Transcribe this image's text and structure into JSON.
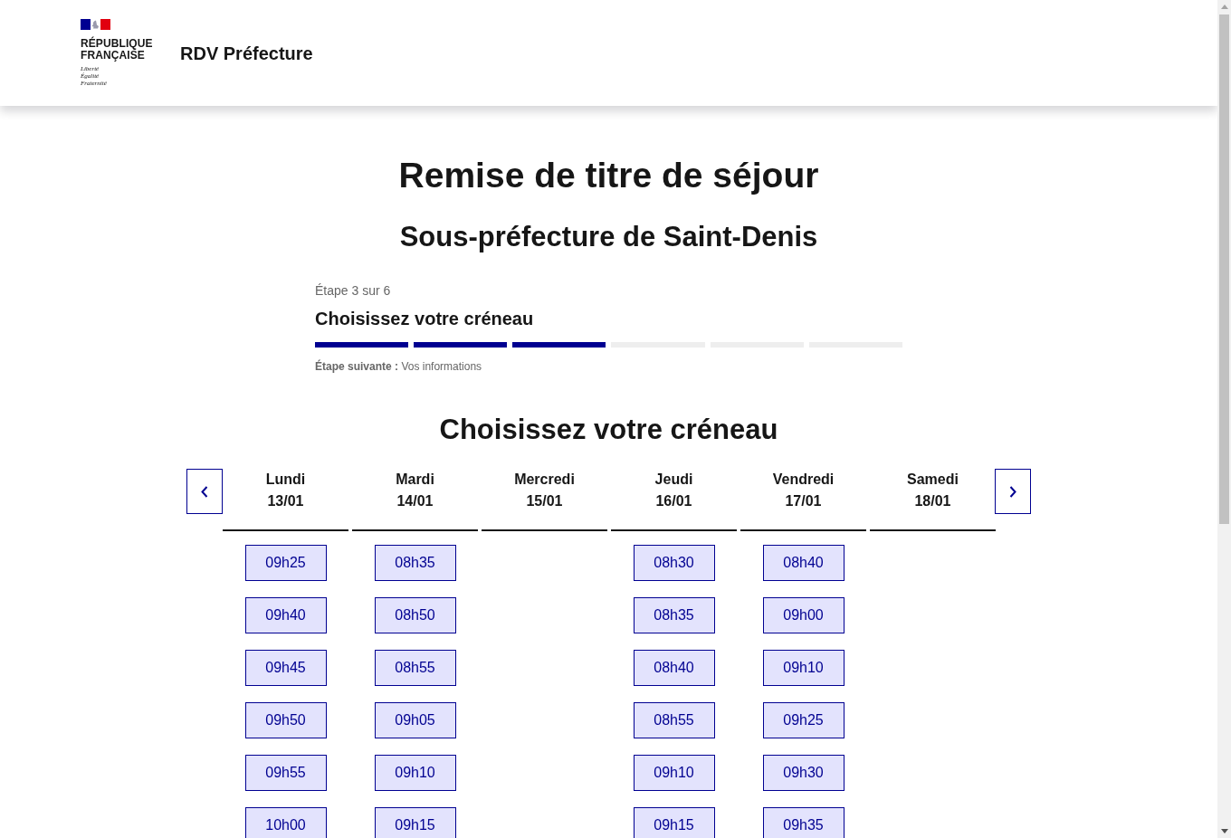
{
  "header": {
    "logo_name": "RÉPUBLIQUE\nFRANÇAISE",
    "motto": "Liberté\nÉgalité\nFraternité",
    "service_title": "RDV Préfecture"
  },
  "page": {
    "title": "Remise de titre de séjour",
    "subtitle": "Sous-préfecture de Saint-Denis"
  },
  "stepper": {
    "step_label": "Étape 3 sur 6",
    "current_title": "Choisissez votre créneau",
    "segments": [
      {
        "done": true
      },
      {
        "done": true
      },
      {
        "done": true
      },
      {
        "done": false
      },
      {
        "done": false
      },
      {
        "done": false
      }
    ],
    "next_label": "Étape suivante :",
    "next_value": "Vos informations"
  },
  "calendar": {
    "title": "Choisissez votre créneau",
    "days": [
      {
        "name": "Lundi",
        "date": "13/01",
        "slots": [
          "09h25",
          "09h40",
          "09h45",
          "09h50",
          "09h55",
          "10h00"
        ]
      },
      {
        "name": "Mardi",
        "date": "14/01",
        "slots": [
          "08h35",
          "08h50",
          "08h55",
          "09h05",
          "09h10",
          "09h15"
        ]
      },
      {
        "name": "Mercredi",
        "date": "15/01"
      },
      {
        "name": "Jeudi",
        "date": "16/01",
        "slots": [
          "08h30",
          "08h35",
          "08h40",
          "08h55",
          "09h10",
          "09h15"
        ]
      },
      {
        "name": "Vendredi",
        "date": "17/01",
        "slots": [
          "08h40",
          "09h00",
          "09h10",
          "09h25",
          "09h30",
          "09h35"
        ]
      },
      {
        "name": "Samedi",
        "date": "18/01"
      }
    ]
  }
}
